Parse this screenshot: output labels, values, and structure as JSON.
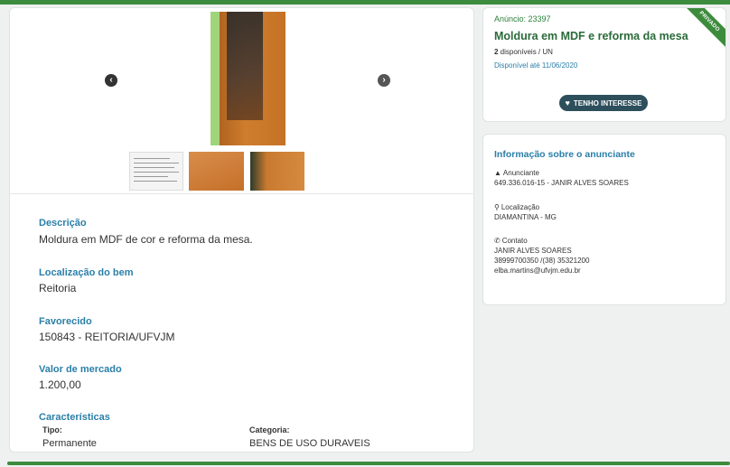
{
  "gallery": {
    "prev_icon": "chevron-left-icon",
    "next_icon": "chevron-right-icon",
    "thumbnails": [
      "document-thumbnail",
      "wood-thumbnail",
      "door-thumbnail"
    ]
  },
  "description": {
    "label": "Descrição",
    "value": "Moldura em MDF de cor e reforma da mesa."
  },
  "location": {
    "label": "Localização do bem",
    "value": "Reitoria"
  },
  "beneficiary": {
    "label": "Favorecido",
    "value": "150843 - REITORIA/UFVJM"
  },
  "market_value": {
    "label": "Valor de mercado",
    "value": "1.200,00"
  },
  "characteristics": {
    "label": "Características",
    "type_label": "Tipo:",
    "type_value": "Permanente",
    "category_label": "Categoria:",
    "category_value": "BENS DE USO DURAVEIS"
  },
  "ad": {
    "ribbon": "PRIVADO",
    "number": "Anúncio: 23397",
    "title": "Moldura em MDF e reforma da mesa",
    "available_count": "2",
    "available_text": " disponíveis / UN",
    "available_until": "Disponível até 11/06/2020",
    "interest_button": "TENHO INTERESSE",
    "colors": {
      "primary": "#3d8b3d",
      "accent": "#2a7fa8",
      "button": "#2d4f5c"
    }
  },
  "advertiser_info": {
    "title": "Informação sobre o anunciante",
    "advertiser_label": "Anunciante",
    "advertiser_value": "649.336.016-15 - JANIR ALVES SOARES",
    "location_label": "Localização",
    "location_value": "DIAMANTINA - MG",
    "contact_label": "Contato",
    "contact_name": "JANIR ALVES SOARES",
    "contact_phone": "38999700350 /(38) 35321200",
    "contact_email": "elba.martins@ufvjm.edu.br"
  }
}
